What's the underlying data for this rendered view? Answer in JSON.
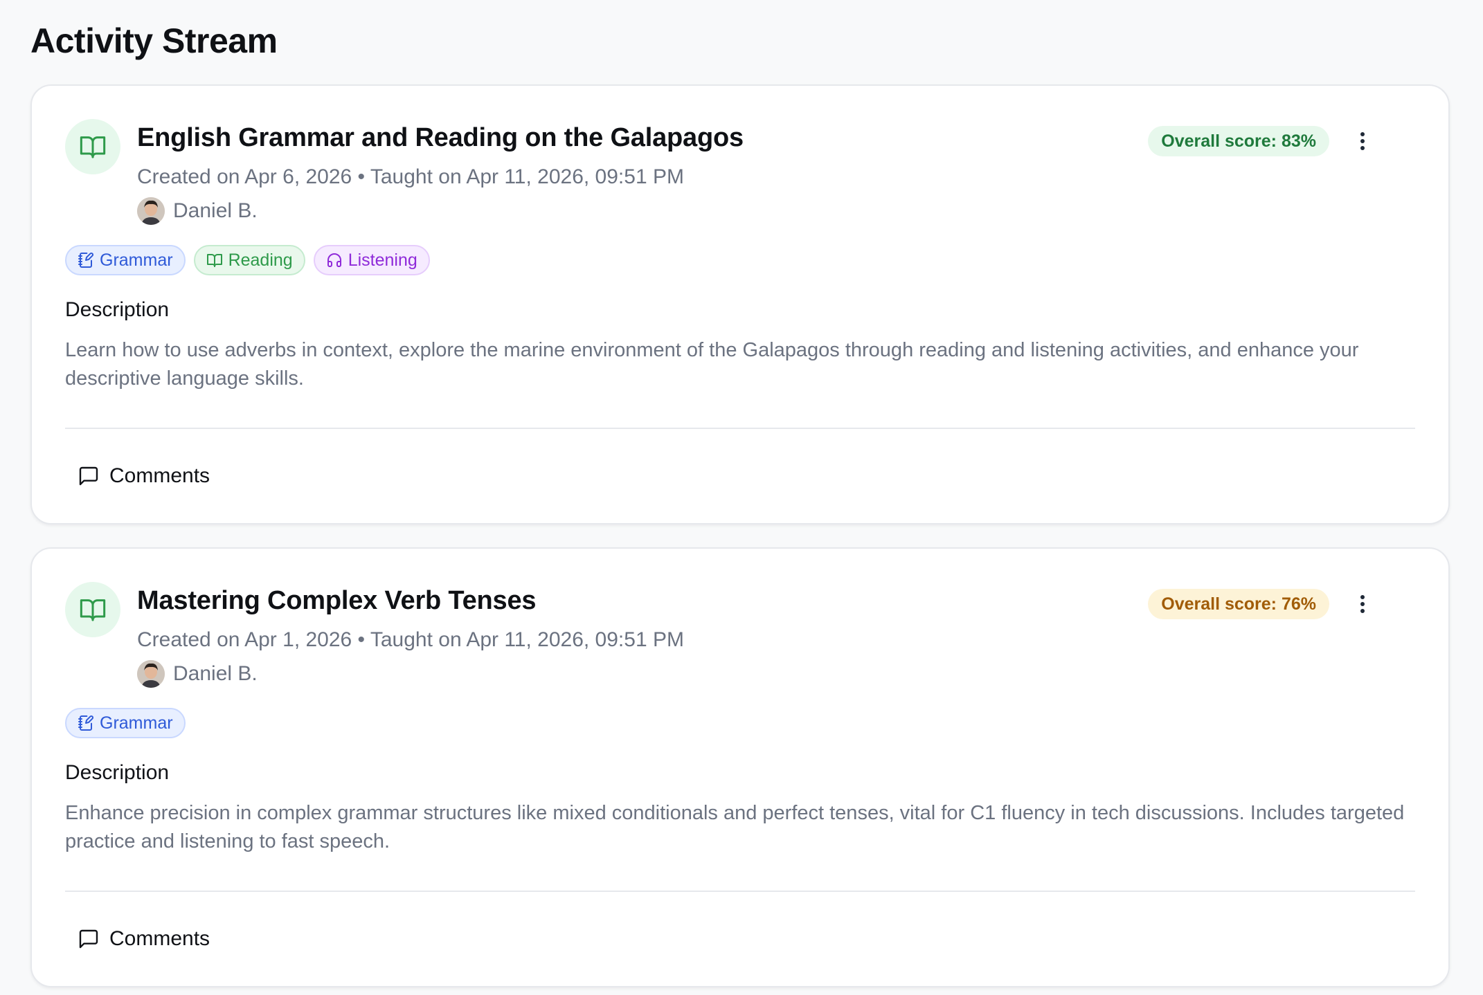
{
  "page": {
    "title": "Activity Stream"
  },
  "colors": {
    "accent_green": "#2e9a4a",
    "grammar_blue": "#2f5ad8",
    "listening_purple": "#8f2bd9",
    "score_amber": "#a15c07"
  },
  "lessons": [
    {
      "icon": "open-book-icon",
      "title": "English Grammar and Reading on the Galapagos",
      "meta": "Created on Apr 6, 2026 • Taught on Apr 11, 2026, 09:51 PM",
      "teacher": "Daniel B.",
      "score": "Overall score: 83%",
      "tags": [
        {
          "label": "Grammar",
          "icon": "edit-note-icon"
        },
        {
          "label": "Reading",
          "icon": "open-book-icon"
        },
        {
          "label": "Listening",
          "icon": "headphones-icon"
        }
      ],
      "description_label": "Description",
      "description": "Learn how to use adverbs in context, explore the marine environment of the Galapagos through reading and listening activities, and enhance your descriptive language skills.",
      "comments_label": "Comments"
    },
    {
      "icon": "open-book-icon",
      "title": "Mastering Complex Verb Tenses",
      "meta": "Created on Apr 1, 2026 • Taught on Apr 11, 2026, 09:51 PM",
      "teacher": "Daniel B.",
      "score": "Overall score: 76%",
      "tags": [
        {
          "label": "Grammar",
          "icon": "edit-note-icon"
        }
      ],
      "description_label": "Description",
      "description": "Enhance precision in complex grammar structures like mixed conditionals and perfect tenses, vital for C1 fluency in tech discussions. Includes targeted practice and listening to fast speech.",
      "comments_label": "Comments"
    }
  ]
}
